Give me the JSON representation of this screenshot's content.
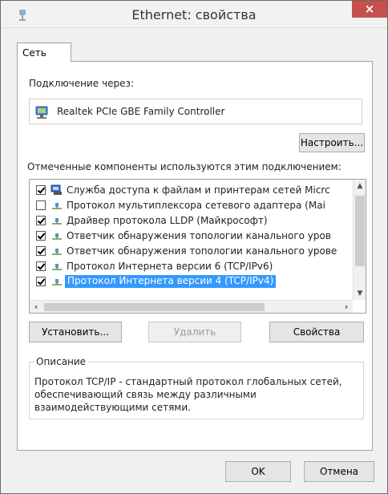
{
  "window": {
    "title": "Ethernet: свойства",
    "close_label": "×"
  },
  "tab": {
    "label": "Сеть"
  },
  "connection": {
    "label": "Подключение через:",
    "adapter": "Realtek PCIe GBE Family Controller",
    "configure_button": "Настроить..."
  },
  "components": {
    "label": "Отмеченные компоненты используются этим подключением:",
    "items": [
      {
        "label": "Служба доступа к файлам и принтерам сетей Micrc",
        "checked": true,
        "icon": "file-printer-sharing-icon"
      },
      {
        "label": "Протокол мультиплексора сетевого адаптера (Маі",
        "checked": false,
        "icon": "protocol-icon"
      },
      {
        "label": "Драйвер протокола LLDP (Майкрософт)",
        "checked": true,
        "icon": "protocol-icon"
      },
      {
        "label": "Ответчик обнаружения топологии канального уров",
        "checked": true,
        "icon": "protocol-icon"
      },
      {
        "label": "Ответчик обнаружения топологии канального урове",
        "checked": true,
        "icon": "protocol-icon"
      },
      {
        "label": "Протокол Интернета версии 6 (TCP/IPv6)",
        "checked": true,
        "icon": "protocol-icon"
      },
      {
        "label": "Протокол Интернета версии 4 (TCP/IPv4)",
        "checked": true,
        "icon": "protocol-icon",
        "selected": true
      }
    ]
  },
  "buttons": {
    "install": "Установить...",
    "remove": "Удалить",
    "properties": "Свойства",
    "ok": "OK",
    "cancel": "Отмена"
  },
  "description": {
    "title": "Описание",
    "text": "Протокол TCP/IP - стандартный протокол глобальных сетей, обеспечивающий связь между различными взаимодействующими сетями."
  },
  "colors": {
    "selection": "#3399ff",
    "close_button": "#c7504c"
  }
}
